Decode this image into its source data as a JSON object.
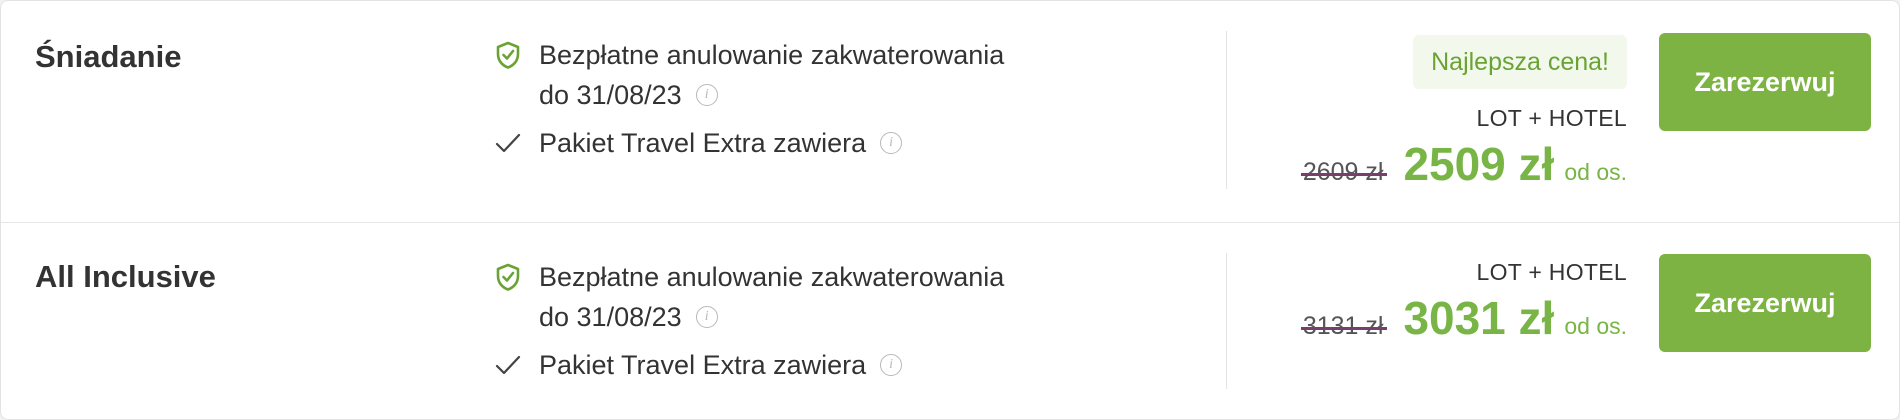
{
  "colors": {
    "accent_green": "#78b546",
    "button_green": "#7cb342",
    "badge_bg": "#f2f9ec",
    "strike": "#7a3d6e"
  },
  "offers": [
    {
      "board": "Śniadanie",
      "cancellation_text": "Bezpłatne anulowanie zakwaterowania",
      "cancellation_date": "do 31/08/23",
      "package_text": "Pakiet Travel Extra zawiera",
      "badge": "Najlepsza cena!",
      "package_type": "LOT + HOTEL",
      "old_price": "2609 zł",
      "price": "2509 zł",
      "per_person": "od os.",
      "button_label": "Zarezerwuj"
    },
    {
      "board": "All Inclusive",
      "cancellation_text": "Bezpłatne anulowanie zakwaterowania",
      "cancellation_date": "do 31/08/23",
      "package_text": "Pakiet Travel Extra zawiera",
      "package_type": "LOT + HOTEL",
      "old_price": "3131 zł",
      "price": "3031 zł",
      "per_person": "od os.",
      "button_label": "Zarezerwuj"
    }
  ],
  "icons": {
    "shield": "shield-check-icon",
    "check": "check-icon",
    "info": "info-icon"
  }
}
